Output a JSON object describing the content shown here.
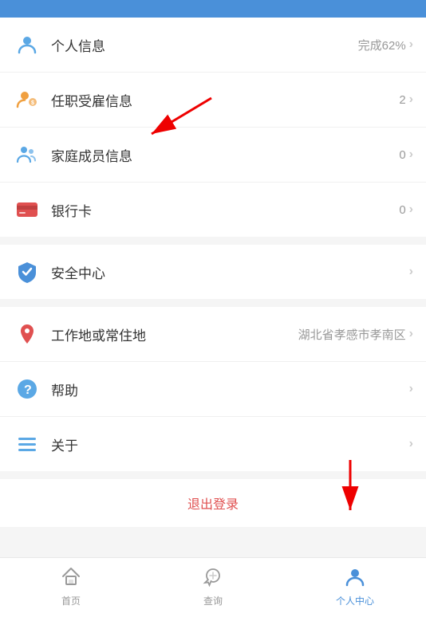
{
  "statusBar": {},
  "menuSections": [
    {
      "items": [
        {
          "id": "personal-info",
          "label": "个人信息",
          "value": "完成62%",
          "icon": "person",
          "iconColor": "#5ba8e5"
        },
        {
          "id": "employment-info",
          "label": "任职受雇信息",
          "value": "2",
          "icon": "employment",
          "iconColor": "#f0a040"
        },
        {
          "id": "family-info",
          "label": "家庭成员信息",
          "value": "0",
          "icon": "family",
          "iconColor": "#5ba8e5"
        },
        {
          "id": "bank-card",
          "label": "银行卡",
          "value": "0",
          "icon": "card",
          "iconColor": "#e05050"
        }
      ]
    },
    {
      "items": [
        {
          "id": "security-center",
          "label": "安全中心",
          "value": "",
          "icon": "shield",
          "iconColor": "#4a90d9"
        }
      ]
    },
    {
      "items": [
        {
          "id": "work-location",
          "label": "工作地或常住地",
          "value": "湖北省孝感市孝南区",
          "icon": "location",
          "iconColor": "#e05050"
        },
        {
          "id": "help",
          "label": "帮助",
          "value": "",
          "icon": "help",
          "iconColor": "#5ba8e5"
        },
        {
          "id": "about",
          "label": "关于",
          "value": "",
          "icon": "menu",
          "iconColor": "#5ba8e5"
        }
      ]
    }
  ],
  "logout": {
    "label": "退出登录"
  },
  "bottomNav": {
    "items": [
      {
        "id": "home",
        "label": "首页",
        "active": false
      },
      {
        "id": "query",
        "label": "查询",
        "active": false
      },
      {
        "id": "profile",
        "label": "个人中心",
        "active": true
      }
    ]
  }
}
